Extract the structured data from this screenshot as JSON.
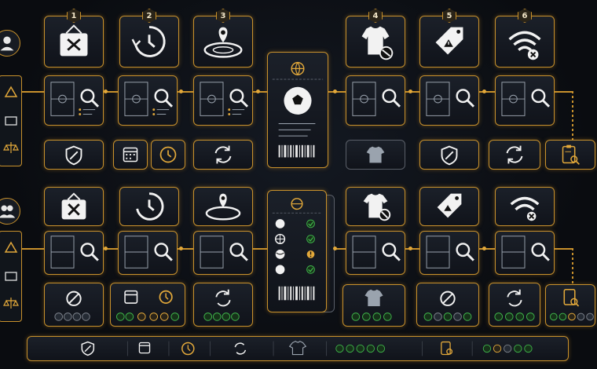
{
  "steps": [
    {
      "number": "1",
      "icon": "no-entry-sign-icon"
    },
    {
      "number": "2",
      "icon": "clock-rewind-icon"
    },
    {
      "number": "3",
      "icon": "stadium-location-icon"
    },
    {
      "number": "4",
      "icon": "shirt-blocked-icon"
    },
    {
      "number": "5",
      "icon": "warning-tag-icon"
    },
    {
      "number": "6",
      "icon": "no-wifi-icon"
    }
  ],
  "rows": [
    {
      "avatar": "single-user-icon"
    },
    {
      "avatar": "group-users-icon"
    }
  ],
  "colors": {
    "accent": "#c8912c",
    "ok": "#3fb24a",
    "warn": "#e2a83a",
    "bg": "#0a0c10"
  }
}
